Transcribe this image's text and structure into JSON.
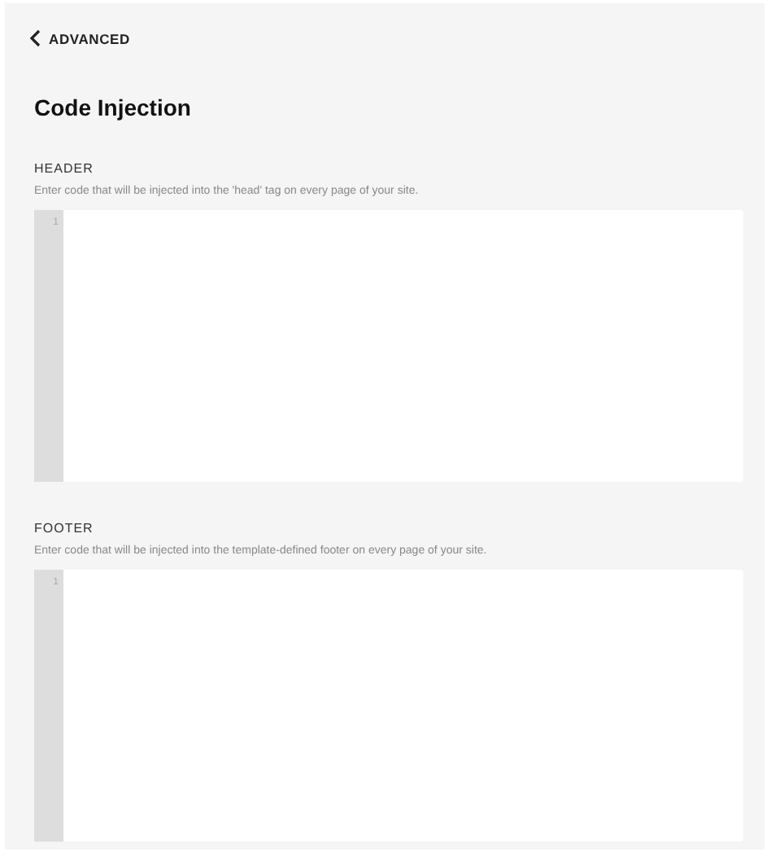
{
  "back_link": {
    "label": "ADVANCED"
  },
  "title": "Code Injection",
  "sections": [
    {
      "heading": "HEADER",
      "description": "Enter code that will be injected into the 'head' tag on every page of your site.",
      "line_numbers": [
        "1"
      ]
    },
    {
      "heading": "FOOTER",
      "description": "Enter code that will be injected into the template-defined footer on every page of your site.",
      "line_numbers": [
        "1"
      ]
    }
  ]
}
